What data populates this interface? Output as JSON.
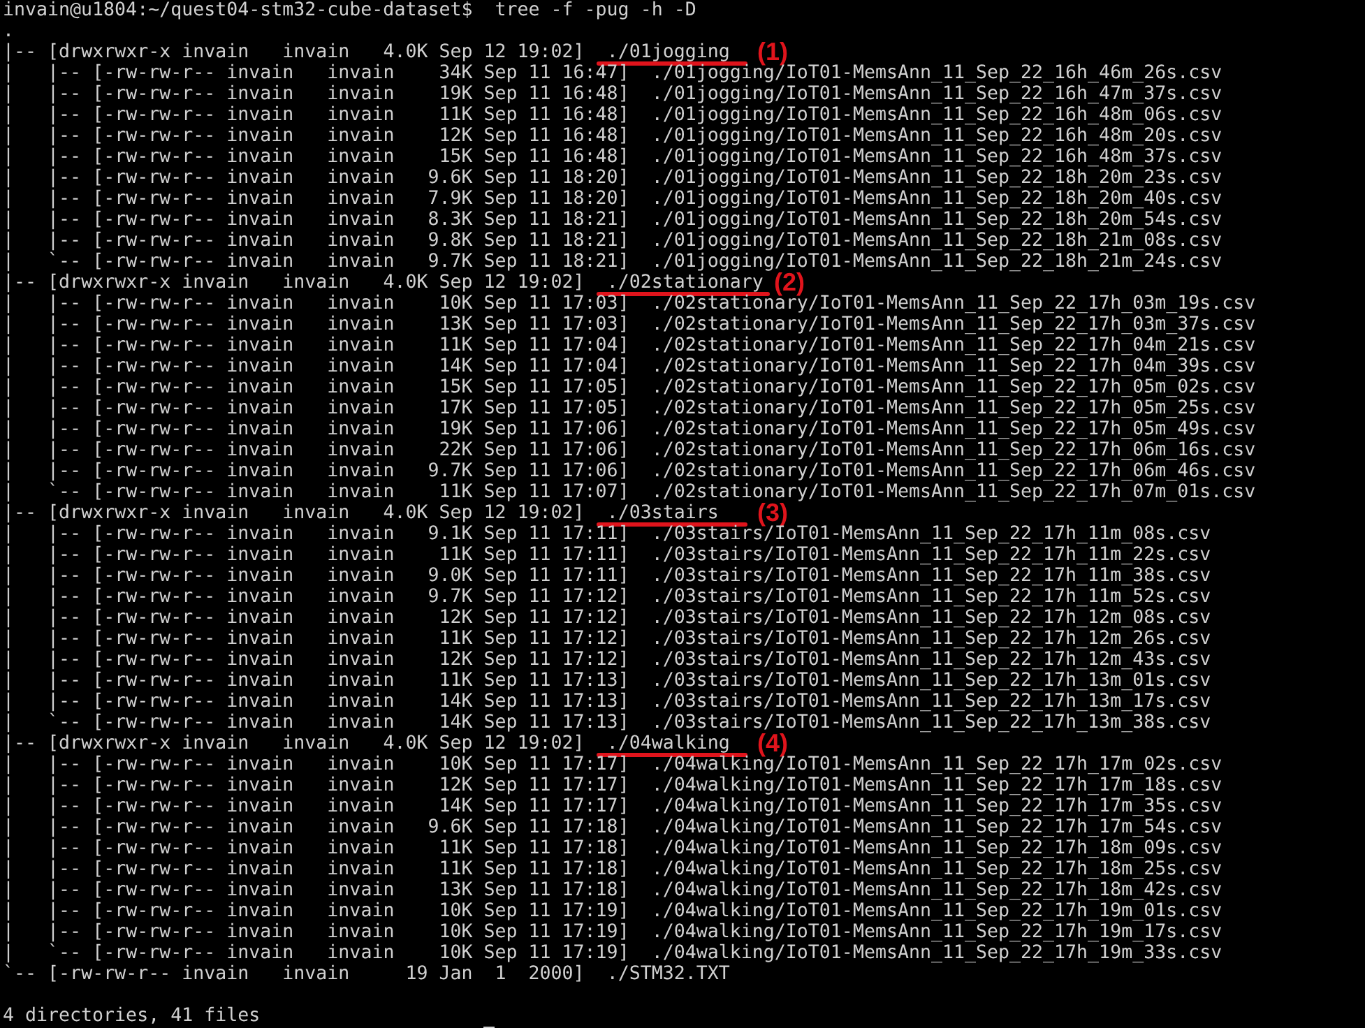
{
  "prompt": "invain@u1804:~/quest04-stm32-cube-dataset$",
  "command": "tree -f -pug -h -D",
  "root": ".",
  "entries": [
    {
      "branch": "|--",
      "info": "[drwxrwxr-x invain   invain   4.0K Sep 12 19:02]",
      "path": "./01jogging",
      "marker": "(1)",
      "children": [
        {
          "branch": "|   |--",
          "info": "[-rw-rw-r-- invain   invain    34K Sep 11 16:47]",
          "path": "./01jogging/IoT01-MemsAnn_11_Sep_22_16h_46m_26s.csv"
        },
        {
          "branch": "|   |--",
          "info": "[-rw-rw-r-- invain   invain    19K Sep 11 16:48]",
          "path": "./01jogging/IoT01-MemsAnn_11_Sep_22_16h_47m_37s.csv"
        },
        {
          "branch": "|   |--",
          "info": "[-rw-rw-r-- invain   invain    11K Sep 11 16:48]",
          "path": "./01jogging/IoT01-MemsAnn_11_Sep_22_16h_48m_06s.csv"
        },
        {
          "branch": "|   |--",
          "info": "[-rw-rw-r-- invain   invain    12K Sep 11 16:48]",
          "path": "./01jogging/IoT01-MemsAnn_11_Sep_22_16h_48m_20s.csv"
        },
        {
          "branch": "|   |--",
          "info": "[-rw-rw-r-- invain   invain    15K Sep 11 16:48]",
          "path": "./01jogging/IoT01-MemsAnn_11_Sep_22_16h_48m_37s.csv"
        },
        {
          "branch": "|   |--",
          "info": "[-rw-rw-r-- invain   invain   9.6K Sep 11 18:20]",
          "path": "./01jogging/IoT01-MemsAnn_11_Sep_22_18h_20m_23s.csv"
        },
        {
          "branch": "|   |--",
          "info": "[-rw-rw-r-- invain   invain   7.9K Sep 11 18:20]",
          "path": "./01jogging/IoT01-MemsAnn_11_Sep_22_18h_20m_40s.csv"
        },
        {
          "branch": "|   |--",
          "info": "[-rw-rw-r-- invain   invain   8.3K Sep 11 18:21]",
          "path": "./01jogging/IoT01-MemsAnn_11_Sep_22_18h_20m_54s.csv"
        },
        {
          "branch": "|   |--",
          "info": "[-rw-rw-r-- invain   invain   9.8K Sep 11 18:21]",
          "path": "./01jogging/IoT01-MemsAnn_11_Sep_22_18h_21m_08s.csv"
        },
        {
          "branch": "|   `--",
          "info": "[-rw-rw-r-- invain   invain   9.7K Sep 11 18:21]",
          "path": "./01jogging/IoT01-MemsAnn_11_Sep_22_18h_21m_24s.csv"
        }
      ]
    },
    {
      "branch": "|--",
      "info": "[drwxrwxr-x invain   invain   4.0K Sep 12 19:02]",
      "path": "./02stationary",
      "marker": "(2)",
      "children": [
        {
          "branch": "|   |--",
          "info": "[-rw-rw-r-- invain   invain    10K Sep 11 17:03]",
          "path": "./02stationary/IoT01-MemsAnn_11_Sep_22_17h_03m_19s.csv"
        },
        {
          "branch": "|   |--",
          "info": "[-rw-rw-r-- invain   invain    13K Sep 11 17:03]",
          "path": "./02stationary/IoT01-MemsAnn_11_Sep_22_17h_03m_37s.csv"
        },
        {
          "branch": "|   |--",
          "info": "[-rw-rw-r-- invain   invain    11K Sep 11 17:04]",
          "path": "./02stationary/IoT01-MemsAnn_11_Sep_22_17h_04m_21s.csv"
        },
        {
          "branch": "|   |--",
          "info": "[-rw-rw-r-- invain   invain    14K Sep 11 17:04]",
          "path": "./02stationary/IoT01-MemsAnn_11_Sep_22_17h_04m_39s.csv"
        },
        {
          "branch": "|   |--",
          "info": "[-rw-rw-r-- invain   invain    15K Sep 11 17:05]",
          "path": "./02stationary/IoT01-MemsAnn_11_Sep_22_17h_05m_02s.csv"
        },
        {
          "branch": "|   |--",
          "info": "[-rw-rw-r-- invain   invain    17K Sep 11 17:05]",
          "path": "./02stationary/IoT01-MemsAnn_11_Sep_22_17h_05m_25s.csv"
        },
        {
          "branch": "|   |--",
          "info": "[-rw-rw-r-- invain   invain    19K Sep 11 17:06]",
          "path": "./02stationary/IoT01-MemsAnn_11_Sep_22_17h_05m_49s.csv"
        },
        {
          "branch": "|   |--",
          "info": "[-rw-rw-r-- invain   invain    22K Sep 11 17:06]",
          "path": "./02stationary/IoT01-MemsAnn_11_Sep_22_17h_06m_16s.csv"
        },
        {
          "branch": "|   |--",
          "info": "[-rw-rw-r-- invain   invain   9.7K Sep 11 17:06]",
          "path": "./02stationary/IoT01-MemsAnn_11_Sep_22_17h_06m_46s.csv"
        },
        {
          "branch": "|   `--",
          "info": "[-rw-rw-r-- invain   invain    11K Sep 11 17:07]",
          "path": "./02stationary/IoT01-MemsAnn_11_Sep_22_17h_07m_01s.csv"
        }
      ]
    },
    {
      "branch": "|--",
      "info": "[drwxrwxr-x invain   invain   4.0K Sep 12 19:02]",
      "path": "./03stairs",
      "marker": "(3)",
      "children": [
        {
          "branch": "|   |--",
          "info": "[-rw-rw-r-- invain   invain   9.1K Sep 11 17:11]",
          "path": "./03stairs/IoT01-MemsAnn_11_Sep_22_17h_11m_08s.csv"
        },
        {
          "branch": "|   |--",
          "info": "[-rw-rw-r-- invain   invain    11K Sep 11 17:11]",
          "path": "./03stairs/IoT01-MemsAnn_11_Sep_22_17h_11m_22s.csv"
        },
        {
          "branch": "|   |--",
          "info": "[-rw-rw-r-- invain   invain   9.0K Sep 11 17:11]",
          "path": "./03stairs/IoT01-MemsAnn_11_Sep_22_17h_11m_38s.csv"
        },
        {
          "branch": "|   |--",
          "info": "[-rw-rw-r-- invain   invain   9.7K Sep 11 17:12]",
          "path": "./03stairs/IoT01-MemsAnn_11_Sep_22_17h_11m_52s.csv"
        },
        {
          "branch": "|   |--",
          "info": "[-rw-rw-r-- invain   invain    12K Sep 11 17:12]",
          "path": "./03stairs/IoT01-MemsAnn_11_Sep_22_17h_12m_08s.csv"
        },
        {
          "branch": "|   |--",
          "info": "[-rw-rw-r-- invain   invain    11K Sep 11 17:12]",
          "path": "./03stairs/IoT01-MemsAnn_11_Sep_22_17h_12m_26s.csv"
        },
        {
          "branch": "|   |--",
          "info": "[-rw-rw-r-- invain   invain    12K Sep 11 17:12]",
          "path": "./03stairs/IoT01-MemsAnn_11_Sep_22_17h_12m_43s.csv"
        },
        {
          "branch": "|   |--",
          "info": "[-rw-rw-r-- invain   invain    11K Sep 11 17:13]",
          "path": "./03stairs/IoT01-MemsAnn_11_Sep_22_17h_13m_01s.csv"
        },
        {
          "branch": "|   |--",
          "info": "[-rw-rw-r-- invain   invain    14K Sep 11 17:13]",
          "path": "./03stairs/IoT01-MemsAnn_11_Sep_22_17h_13m_17s.csv"
        },
        {
          "branch": "|   `--",
          "info": "[-rw-rw-r-- invain   invain    14K Sep 11 17:13]",
          "path": "./03stairs/IoT01-MemsAnn_11_Sep_22_17h_13m_38s.csv"
        }
      ]
    },
    {
      "branch": "|--",
      "info": "[drwxrwxr-x invain   invain   4.0K Sep 12 19:02]",
      "path": "./04walking",
      "marker": "(4)",
      "children": [
        {
          "branch": "|   |--",
          "info": "[-rw-rw-r-- invain   invain    10K Sep 11 17:17]",
          "path": "./04walking/IoT01-MemsAnn_11_Sep_22_17h_17m_02s.csv"
        },
        {
          "branch": "|   |--",
          "info": "[-rw-rw-r-- invain   invain    12K Sep 11 17:17]",
          "path": "./04walking/IoT01-MemsAnn_11_Sep_22_17h_17m_18s.csv"
        },
        {
          "branch": "|   |--",
          "info": "[-rw-rw-r-- invain   invain    14K Sep 11 17:17]",
          "path": "./04walking/IoT01-MemsAnn_11_Sep_22_17h_17m_35s.csv"
        },
        {
          "branch": "|   |--",
          "info": "[-rw-rw-r-- invain   invain   9.6K Sep 11 17:18]",
          "path": "./04walking/IoT01-MemsAnn_11_Sep_22_17h_17m_54s.csv"
        },
        {
          "branch": "|   |--",
          "info": "[-rw-rw-r-- invain   invain    11K Sep 11 17:18]",
          "path": "./04walking/IoT01-MemsAnn_11_Sep_22_17h_18m_09s.csv"
        },
        {
          "branch": "|   |--",
          "info": "[-rw-rw-r-- invain   invain    11K Sep 11 17:18]",
          "path": "./04walking/IoT01-MemsAnn_11_Sep_22_17h_18m_25s.csv"
        },
        {
          "branch": "|   |--",
          "info": "[-rw-rw-r-- invain   invain    13K Sep 11 17:18]",
          "path": "./04walking/IoT01-MemsAnn_11_Sep_22_17h_18m_42s.csv"
        },
        {
          "branch": "|   |--",
          "info": "[-rw-rw-r-- invain   invain    10K Sep 11 17:19]",
          "path": "./04walking/IoT01-MemsAnn_11_Sep_22_17h_19m_01s.csv"
        },
        {
          "branch": "|   |--",
          "info": "[-rw-rw-r-- invain   invain    10K Sep 11 17:19]",
          "path": "./04walking/IoT01-MemsAnn_11_Sep_22_17h_19m_17s.csv"
        },
        {
          "branch": "|   `--",
          "info": "[-rw-rw-r-- invain   invain    10K Sep 11 17:19]",
          "path": "./04walking/IoT01-MemsAnn_11_Sep_22_17h_19m_33s.csv"
        }
      ]
    },
    {
      "branch": "`--",
      "info": "[-rw-rw-r-- invain   invain     19 Jan  1  2000]",
      "path": "./STM32.TXT"
    }
  ],
  "summary": "4 directories, 41 files"
}
